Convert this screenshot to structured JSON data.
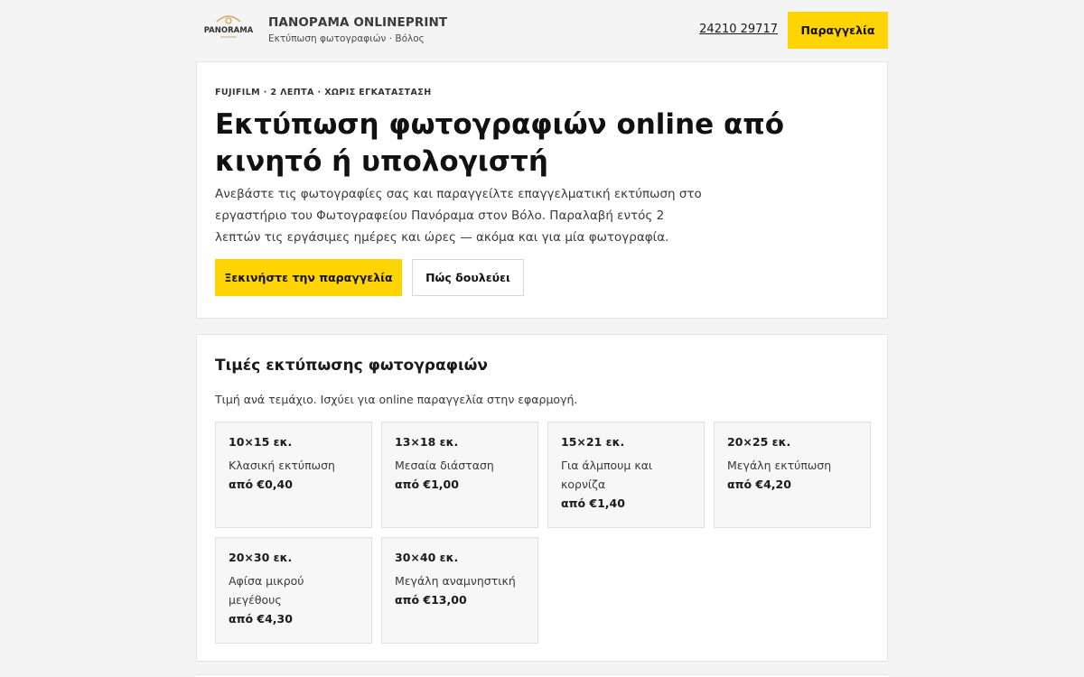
{
  "header": {
    "logo_text": "PANORAMA",
    "brand_title": "ΠΑΝΟΡΑΜΑ ONLINEPRINT",
    "brand_subtitle": "Εκτύπωση φωτογραφιών · Βόλος",
    "phone": "24210 29717",
    "order_button": "Παραγγελία"
  },
  "hero": {
    "eyebrow": "FUJIFILM · 2 ΛΕΠΤΑ · ΧΩΡΙΣ ΕΓΚΑΤΑΣΤΑΣΗ",
    "title": "Εκτύπωση φωτογραφιών online από κινητό ή υπολογιστή",
    "description": "Ανεβάστε τις φωτογραφίες σας και παραγγείλτε επαγγελματική εκτύπωση στο εργαστήριο του Φωτογραφείου Πανόραμα στον Βόλο. Παραλαβή εντός 2 λεπτών τις εργάσιμες ημέρες και ώρες — ακόμα και για μία φωτογραφία.",
    "primary_button": "Ξεκινήστε την παραγγελία",
    "secondary_button": "Πώς δουλεύει"
  },
  "prices": {
    "title": "Τιμές εκτύπωσης φωτογραφιών",
    "note": "Τιμή ανά τεμάχιο. Ισχύει για online παραγγελία στην εφαρμογή.",
    "items": [
      {
        "size": "10×15 εκ.",
        "desc": "Κλασική εκτύπωση",
        "price": "από €0,40"
      },
      {
        "size": "13×18 εκ.",
        "desc": "Μεσαία διάσταση",
        "price": "από €1,00"
      },
      {
        "size": "15×21 εκ.",
        "desc": "Για άλμπουμ και κορνίζα",
        "price": "από €1,40"
      },
      {
        "size": "20×25 εκ.",
        "desc": "Μεγάλη εκτύπωση",
        "price": "από €4,20"
      },
      {
        "size": "20×30 εκ.",
        "desc": "Αφίσα μικρού μεγέθους",
        "price": "από €4,30"
      },
      {
        "size": "30×40 εκ.",
        "desc": "Μεγάλη αναμνηστική",
        "price": "από €13,00"
      }
    ]
  },
  "colors": {
    "accent": "#ffd400",
    "background": "#f4f4f4",
    "card": "#ffffff"
  }
}
